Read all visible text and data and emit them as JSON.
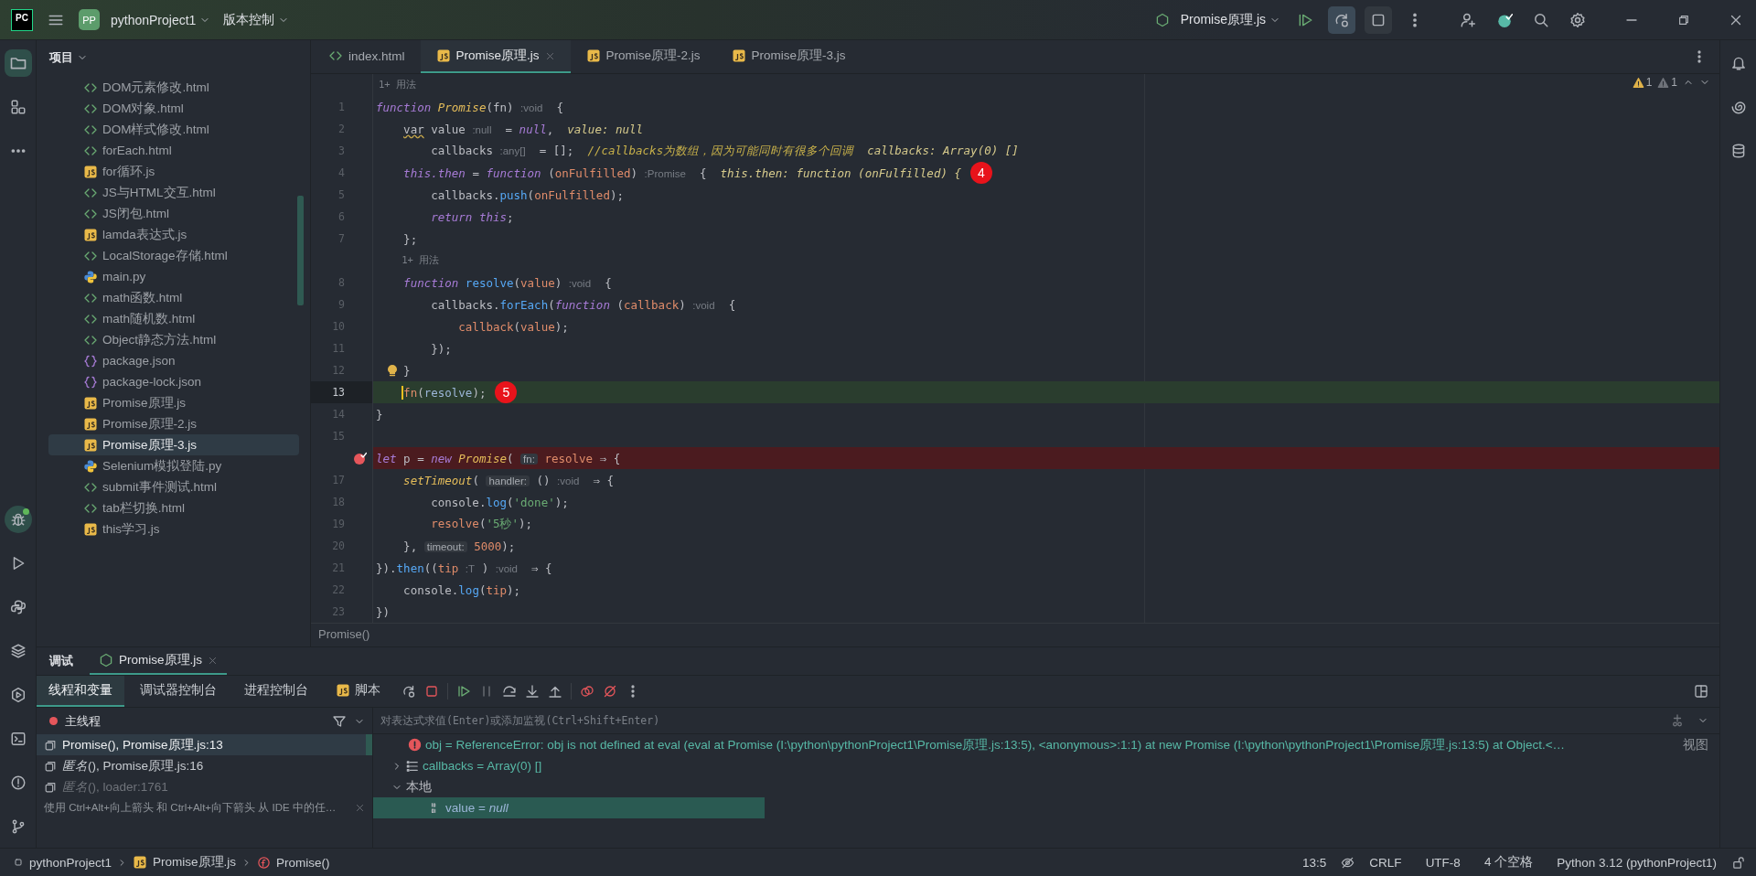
{
  "title_bar": {
    "logo": "PC",
    "project_badge": "PP",
    "project": "pythonProject1",
    "vcs": "版本控制",
    "run_config": "Promise原理.js"
  },
  "project_panel": {
    "title": "项目",
    "items": [
      {
        "kind": "html",
        "label": "DOM元素修改.html",
        "selected": false
      },
      {
        "kind": "html",
        "label": "DOM对象.html",
        "selected": false
      },
      {
        "kind": "html",
        "label": "DOM样式修改.html",
        "selected": false
      },
      {
        "kind": "html",
        "label": "forEach.html",
        "selected": false
      },
      {
        "kind": "js",
        "label": "for循环.js",
        "selected": false
      },
      {
        "kind": "html",
        "label": "JS与HTML交互.html",
        "selected": false
      },
      {
        "kind": "html",
        "label": "JS闭包.html",
        "selected": false
      },
      {
        "kind": "js",
        "label": "lamda表达式.js",
        "selected": false
      },
      {
        "kind": "html",
        "label": "LocalStorage存储.html",
        "selected": false
      },
      {
        "kind": "py",
        "label": "main.py",
        "selected": false
      },
      {
        "kind": "html",
        "label": "math函数.html",
        "selected": false
      },
      {
        "kind": "html",
        "label": "math随机数.html",
        "selected": false
      },
      {
        "kind": "html",
        "label": "Object静态方法.html",
        "selected": false
      },
      {
        "kind": "json",
        "label": "package.json",
        "selected": false
      },
      {
        "kind": "json",
        "label": "package-lock.json",
        "selected": false
      },
      {
        "kind": "js",
        "label": "Promise原理.js",
        "selected": false
      },
      {
        "kind": "js",
        "label": "Promise原理-2.js",
        "selected": false
      },
      {
        "kind": "js",
        "label": "Promise原理-3.js",
        "selected": true
      },
      {
        "kind": "py",
        "label": "Selenium模拟登陆.py",
        "selected": false
      },
      {
        "kind": "html",
        "label": "submit事件测试.html",
        "selected": false
      },
      {
        "kind": "html",
        "label": "tab栏切换.html",
        "selected": false
      },
      {
        "kind": "js",
        "label": "this学习.js",
        "selected": false
      }
    ]
  },
  "editor": {
    "tabs": [
      {
        "kind": "html",
        "label": "index.html",
        "selected": false
      },
      {
        "kind": "js",
        "label": "Promise原理.js",
        "selected": true
      },
      {
        "kind": "js",
        "label": "Promise原理-2.js",
        "selected": false
      },
      {
        "kind": "js",
        "label": "Promise原理-3.js",
        "selected": false
      }
    ],
    "inspections": [
      {
        "kind": "warning",
        "count": "1"
      },
      {
        "kind": "weak",
        "count": "1"
      }
    ],
    "lines": [
      {
        "kind": "usage",
        "text": "1+ 用法"
      },
      {
        "kind": "code",
        "number": "1",
        "tokens": [
          {
            "kind": "kw",
            "text": "function "
          },
          {
            "kind": "fnname",
            "text": "Promise"
          },
          {
            "kind": "plain",
            "text": "(fn) "
          },
          {
            "kind": "hint",
            "text": ":void"
          },
          {
            "kind": "plain",
            "text": "  {"
          }
        ]
      },
      {
        "kind": "code",
        "number": "2",
        "tokens": [
          {
            "kind": "warn",
            "text": "    var"
          },
          {
            "kind": "plain",
            "text": " value "
          },
          {
            "kind": "hint",
            "text": ":null"
          },
          {
            "kind": "plain",
            "text": "  = "
          },
          {
            "kind": "kw",
            "text": "null"
          },
          {
            "kind": "plain",
            "text": ",  "
          },
          {
            "kind": "inline",
            "text": "value: null"
          }
        ]
      },
      {
        "kind": "code",
        "number": "3",
        "tokens": [
          {
            "kind": "plain",
            "text": "        callbacks "
          },
          {
            "kind": "hint",
            "text": ":any[]"
          },
          {
            "kind": "plain",
            "text": "  = [];  "
          },
          {
            "kind": "comment",
            "text": "//callbacks为数组，因为可能同时有很多个回调"
          },
          {
            "kind": "inline",
            "text": "  callbacks: Array(0) []"
          }
        ]
      },
      {
        "kind": "code",
        "number": "4",
        "marker": "4",
        "tokens": [
          {
            "kind": "kw",
            "text": "    this.then"
          },
          {
            "kind": "plain",
            "text": " = "
          },
          {
            "kind": "kw",
            "text": "function"
          },
          {
            "kind": "plain",
            "text": " ("
          },
          {
            "kind": "param",
            "text": "onFulfilled"
          },
          {
            "kind": "plain",
            "text": ") "
          },
          {
            "kind": "hint",
            "text": ":Promise"
          },
          {
            "kind": "plain",
            "text": "  {  "
          },
          {
            "kind": "inline",
            "text": "this.then: function (onFulfilled) {"
          }
        ]
      },
      {
        "kind": "code",
        "number": "5",
        "tokens": [
          {
            "kind": "plain",
            "text": "        callbacks."
          },
          {
            "kind": "method",
            "text": "push"
          },
          {
            "kind": "plain",
            "text": "("
          },
          {
            "kind": "param",
            "text": "onFulfilled"
          },
          {
            "kind": "plain",
            "text": ");"
          }
        ]
      },
      {
        "kind": "code",
        "number": "6",
        "tokens": [
          {
            "kind": "kw",
            "text": "        return this"
          },
          {
            "kind": "plain",
            "text": ";"
          }
        ]
      },
      {
        "kind": "code",
        "number": "7",
        "tokens": [
          {
            "kind": "plain",
            "text": "    };"
          }
        ]
      },
      {
        "kind": "usage",
        "text": "    1+ 用法"
      },
      {
        "kind": "code",
        "number": "8",
        "tokens": [
          {
            "kind": "kw",
            "text": "    function"
          },
          {
            "kind": "method",
            "text": " resolve"
          },
          {
            "kind": "plain",
            "text": "("
          },
          {
            "kind": "param",
            "text": "value"
          },
          {
            "kind": "plain",
            "text": ") "
          },
          {
            "kind": "hint",
            "text": ":void"
          },
          {
            "kind": "plain",
            "text": "  {"
          }
        ]
      },
      {
        "kind": "code",
        "number": "9",
        "tokens": [
          {
            "kind": "plain",
            "text": "        callbacks."
          },
          {
            "kind": "method",
            "text": "forEach"
          },
          {
            "kind": "plain",
            "text": "("
          },
          {
            "kind": "kw",
            "text": "function"
          },
          {
            "kind": "plain",
            "text": " ("
          },
          {
            "kind": "param",
            "text": "callback"
          },
          {
            "kind": "plain",
            "text": ") "
          },
          {
            "kind": "hint",
            "text": ":void"
          },
          {
            "kind": "plain",
            "text": "  {"
          }
        ]
      },
      {
        "kind": "code",
        "number": "10",
        "tokens": [
          {
            "kind": "param",
            "text": "            callback"
          },
          {
            "kind": "plain",
            "text": "("
          },
          {
            "kind": "param",
            "text": "value"
          },
          {
            "kind": "plain",
            "text": ");"
          }
        ]
      },
      {
        "kind": "code",
        "number": "11",
        "tokens": [
          {
            "kind": "plain",
            "text": "        });"
          }
        ]
      },
      {
        "kind": "intention",
        "number": "12",
        "tokens": [
          {
            "kind": "plain",
            "text": "    }"
          }
        ]
      },
      {
        "kind": "current",
        "number": "13",
        "marker": "5",
        "tokens": [
          {
            "kind": "param",
            "text": "    fn"
          },
          {
            "kind": "plain",
            "text": "("
          },
          {
            "kind": "ref",
            "text": "resolve"
          },
          {
            "kind": "plain",
            "text": ");"
          }
        ]
      },
      {
        "kind": "code",
        "number": "14",
        "tokens": [
          {
            "kind": "plain",
            "text": "}"
          }
        ]
      },
      {
        "kind": "code",
        "number": "15"
      },
      {
        "kind": "breakpoint",
        "tokens": [
          {
            "kind": "kw",
            "text": "let"
          },
          {
            "kind": "plain",
            "text": " p = "
          },
          {
            "kind": "kw",
            "text": "new "
          },
          {
            "kind": "fnname",
            "text": "Promise"
          },
          {
            "kind": "plain",
            "text": "( "
          },
          {
            "kind": "label",
            "text": "fn:"
          },
          {
            "kind": "param",
            "text": " resolve"
          },
          {
            "kind": "plain",
            "text": " ⇒ {"
          }
        ]
      },
      {
        "kind": "code",
        "number": "17",
        "tokens": [
          {
            "kind": "fnname",
            "text": "    setTimeout"
          },
          {
            "kind": "plain",
            "text": "( "
          },
          {
            "kind": "label",
            "text": "handler:"
          },
          {
            "kind": "plain",
            "text": " () "
          },
          {
            "kind": "hint",
            "text": ":void"
          },
          {
            "kind": "plain",
            "text": "  ⇒ {"
          }
        ]
      },
      {
        "kind": "code",
        "number": "18",
        "tokens": [
          {
            "kind": "plain",
            "text": "        console."
          },
          {
            "kind": "method",
            "text": "log"
          },
          {
            "kind": "plain",
            "text": "("
          },
          {
            "kind": "string",
            "text": "'done'"
          },
          {
            "kind": "plain",
            "text": ");"
          }
        ]
      },
      {
        "kind": "code",
        "number": "19",
        "tokens": [
          {
            "kind": "param",
            "text": "        resolve"
          },
          {
            "kind": "plain",
            "text": "("
          },
          {
            "kind": "string",
            "text": "'5秒'"
          },
          {
            "kind": "plain",
            "text": ");"
          }
        ]
      },
      {
        "kind": "code",
        "number": "20",
        "tokens": [
          {
            "kind": "plain",
            "text": "    }, "
          },
          {
            "kind": "label",
            "text": "timeout:"
          },
          {
            "kind": "number",
            "text": " 5000"
          },
          {
            "kind": "plain",
            "text": ");"
          }
        ]
      },
      {
        "kind": "code",
        "number": "21",
        "tokens": [
          {
            "kind": "plain",
            "text": "})."
          },
          {
            "kind": "method",
            "text": "then"
          },
          {
            "kind": "plain",
            "text": "(("
          },
          {
            "kind": "param",
            "text": "tip"
          },
          {
            "kind": "hint",
            "text": " :T"
          },
          {
            "kind": "plain",
            "text": " ) "
          },
          {
            "kind": "hint",
            "text": ":void"
          },
          {
            "kind": "plain",
            "text": "  ⇒ {"
          }
        ]
      },
      {
        "kind": "code",
        "number": "22",
        "tokens": [
          {
            "kind": "plain",
            "text": "    console."
          },
          {
            "kind": "method",
            "text": "log"
          },
          {
            "kind": "plain",
            "text": "("
          },
          {
            "kind": "param",
            "text": "tip"
          },
          {
            "kind": "plain",
            "text": ");"
          }
        ]
      },
      {
        "kind": "code",
        "number": "23",
        "tokens": [
          {
            "kind": "plain",
            "text": "})"
          }
        ]
      }
    ],
    "breadcrumb": "Promise()"
  },
  "debug": {
    "title": "调试",
    "sessions": [
      {
        "label": "Promise原理.js",
        "selected": true
      }
    ],
    "tabs": [
      {
        "kind": "text",
        "label": "线程和变量",
        "selected": true
      },
      {
        "kind": "text",
        "label": "调试器控制台",
        "selected": false
      },
      {
        "kind": "text",
        "label": "进程控制台",
        "selected": false
      },
      {
        "kind": "js",
        "label": "脚本",
        "selected": false
      }
    ],
    "thread": "主线程",
    "frames": [
      {
        "label": "Promise(), Promise原理.js:13",
        "selected": true,
        "greyed": false
      },
      {
        "label": "*匿名*(), Promise原理.js:16",
        "selected": false,
        "greyed": false
      },
      {
        "label": "*匿名*(), loader:1761",
        "selected": false,
        "greyed": true
      }
    ],
    "hint": "使用 Ctrl+Alt+向上箭头 和 Ctrl+Alt+向下箭头 从 IDE 中的任…",
    "eval_placeholder": "对表达式求值(Enter)或添加监视(Ctrl+Shift+Enter)",
    "variables": [
      {
        "kind": "error",
        "text": "obj = ReferenceError: obj is not defined    at eval (eval at Promise (I:\\python\\pythonProject1\\Promise原理.js:13:5), <anonymous>:1:1)    at new Promise (I:\\python\\pythonProject1\\Promise原理.js:13:5)    at Object.<…",
        "link": "视图"
      },
      {
        "kind": "array",
        "text": "callbacks = Array(0) []",
        "expanded": false
      },
      {
        "kind": "group",
        "text": "本地",
        "expanded": true
      },
      {
        "kind": "primitive",
        "text": "value = *null*",
        "selected": true
      }
    ]
  },
  "status_bar": {
    "breadcrumb": [
      {
        "kind": "project",
        "text": "pythonProject1"
      },
      {
        "kind": "js",
        "text": "Promise原理.js"
      },
      {
        "kind": "function",
        "text": "Promise()"
      }
    ],
    "position": "13:5",
    "line_separator": "CRLF",
    "encoding": "UTF-8",
    "indent": "4 个空格",
    "interpreter": "Python 3.12 (pythonProject1)"
  }
}
